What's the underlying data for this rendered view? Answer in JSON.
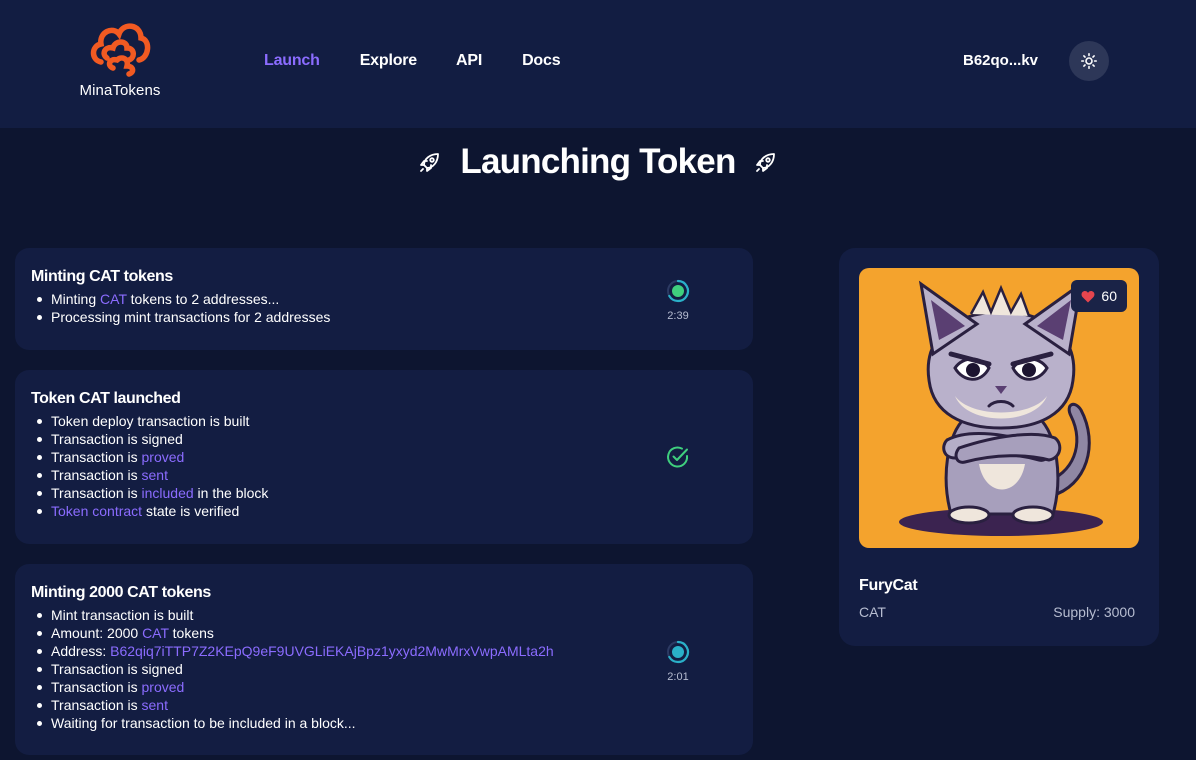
{
  "app": {
    "name": "MinaTokens"
  },
  "nav": {
    "launch": "Launch",
    "explore": "Explore",
    "api": "API",
    "docs": "Docs"
  },
  "wallet": {
    "address": "B62qo...kv"
  },
  "page": {
    "title": "Launching Token"
  },
  "colors": {
    "accent": "#8b6cff",
    "success": "#3fcf7e",
    "progress": "#2ab0c8",
    "background": "#0d1530",
    "card": "#131d42",
    "brand": "#f15a22"
  },
  "steps": [
    {
      "title": "Minting CAT tokens",
      "status": "in-progress",
      "timer": "2:39",
      "items": [
        {
          "parts": [
            "Minting ",
            "CAT",
            " tokens to 2 addresses..."
          ]
        },
        {
          "parts": [
            "Processing mint transactions for 2 addresses"
          ]
        }
      ]
    },
    {
      "title": "Token CAT launched",
      "status": "done",
      "items": [
        {
          "parts": [
            "Token deploy transaction is built"
          ]
        },
        {
          "parts": [
            "Transaction is signed"
          ]
        },
        {
          "parts": [
            "Transaction is ",
            "proved"
          ]
        },
        {
          "parts": [
            "Transaction is ",
            "sent"
          ]
        },
        {
          "parts": [
            "Transaction is ",
            "included",
            " in the block"
          ]
        },
        {
          "parts": [
            "",
            "Token contract",
            " state is verified"
          ]
        }
      ]
    },
    {
      "title": "Minting 2000 CAT tokens",
      "status": "in-progress",
      "timer": "2:01",
      "items": [
        {
          "parts": [
            "Mint transaction is built"
          ]
        },
        {
          "parts": [
            "Amount: 2000 ",
            "CAT",
            " tokens"
          ]
        },
        {
          "parts": [
            "Address: ",
            "B62qiq7iTTP7Z2KEpQ9eF9UVGLiEKAjBpz1yxyd2MwMrxVwpAMLta2h"
          ]
        },
        {
          "parts": [
            "Transaction is signed"
          ]
        },
        {
          "parts": [
            "Transaction is ",
            "proved"
          ]
        },
        {
          "parts": [
            "Transaction is ",
            "sent"
          ]
        },
        {
          "parts": [
            "Waiting for transaction to be included in a block..."
          ]
        }
      ]
    }
  ],
  "token": {
    "name": "FuryCat",
    "symbol": "CAT",
    "supply": "Supply: 3000",
    "likes": "60"
  }
}
